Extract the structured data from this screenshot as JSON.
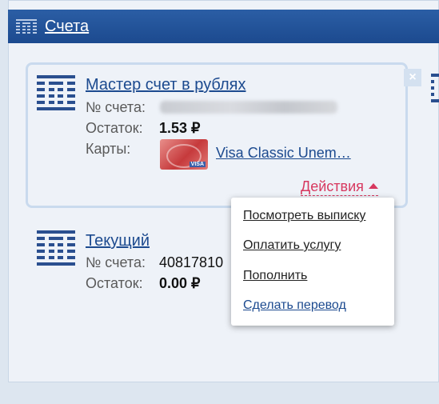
{
  "header": {
    "title": "Счета",
    "icon": "bank-building-icon"
  },
  "accounts": [
    {
      "title": "Мастер счет в рублях",
      "number_label": "№ счета:",
      "balance_label": "Остаток:",
      "balance_value": "1.53 ₽",
      "cards_label": "Карты:",
      "card_name": "Visa Classic Unem…",
      "card_brand": "VISA",
      "actions_label": "Действия"
    },
    {
      "title": "Текущий",
      "number_label": "№ счета:",
      "number_value": "40817810",
      "balance_label": "Остаток:",
      "balance_value": "0.00 ₽"
    }
  ],
  "actions_menu": {
    "items": [
      "Посмотреть выписку",
      "Оплатить услугу",
      "Пополнить",
      "Сделать перевод"
    ]
  },
  "close_label": "×",
  "colors": {
    "header": "#1c4a8f",
    "link": "#1c4a8f",
    "actions": "#d7385f"
  }
}
